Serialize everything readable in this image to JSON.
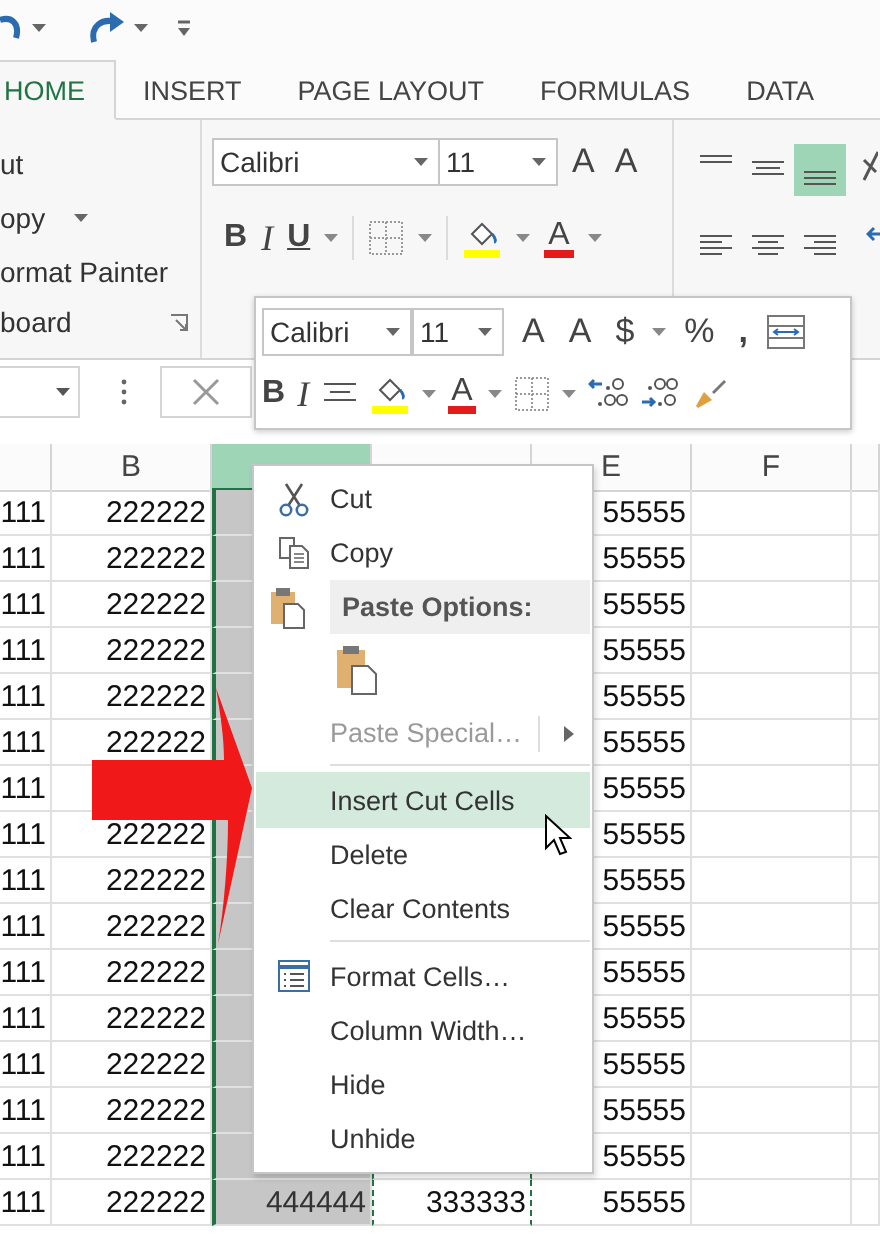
{
  "tabs": [
    {
      "label": "HOME",
      "selected": true
    },
    {
      "label": "INSERT",
      "selected": false
    },
    {
      "label": "PAGE LAYOUT",
      "selected": false
    },
    {
      "label": "FORMULAS",
      "selected": false
    },
    {
      "label": "DATA",
      "selected": false
    }
  ],
  "clipboard_group": {
    "cut": "ut",
    "copy": "opy",
    "format_painter": "ormat Painter",
    "label": "board"
  },
  "font_group": {
    "font": "Calibri",
    "size": "11",
    "grow": "A",
    "shrink": "A",
    "bold": "B",
    "italic": "I",
    "underline": "U",
    "font_color": "A"
  },
  "alignment_group": {
    "vertical": [
      {
        "selected": false
      },
      {
        "selected": false
      },
      {
        "selected": true
      }
    ],
    "horizontal": [
      {
        "selected": false
      },
      {
        "selected": false
      },
      {
        "selected": false
      }
    ]
  },
  "mini_toolbar": {
    "font": "Calibri",
    "size": "11",
    "grow": "A",
    "shrink": "A",
    "currency": "$",
    "percent": "%",
    "comma": ",",
    "bold": "B",
    "italic": "I",
    "font_color": "A"
  },
  "columns": [
    {
      "selected": false,
      "cut": false
    },
    {
      "label": "B",
      "selected": false,
      "cut": false
    },
    {
      "selected": true,
      "cut": false
    },
    {
      "selected": false,
      "cut": true
    },
    {
      "label": "E",
      "selected": false,
      "cut": false
    },
    {
      "label": "F",
      "selected": false,
      "cut": false
    },
    {
      "selected": false,
      "cut": false
    }
  ],
  "rows": [
    {
      "a": "111",
      "b": "222222",
      "e": "55555"
    },
    {
      "a": "111",
      "b": "222222",
      "e": "55555"
    },
    {
      "a": "111",
      "b": "222222",
      "e": "55555"
    },
    {
      "a": "111",
      "b": "222222",
      "e": "55555"
    },
    {
      "a": "111",
      "b": "222222",
      "e": "55555"
    },
    {
      "a": "111",
      "b": "222222",
      "e": "55555"
    },
    {
      "a": "111",
      "e": "55555"
    },
    {
      "a": "111",
      "b": "222222",
      "e": "55555"
    },
    {
      "a": "111",
      "b": "222222",
      "e": "55555"
    },
    {
      "a": "111",
      "b": "222222",
      "e": "55555"
    },
    {
      "a": "111",
      "b": "222222",
      "e": "55555"
    },
    {
      "a": "111",
      "b": "222222",
      "e": "55555"
    },
    {
      "a": "111",
      "b": "222222",
      "e": "55555"
    },
    {
      "a": "111",
      "b": "222222",
      "e": "55555"
    },
    {
      "a": "111",
      "b": "222222",
      "e": "55555"
    },
    {
      "a": "111",
      "b": "222222",
      "c": "444444",
      "d": "333333",
      "e": "55555"
    }
  ],
  "context_menu": {
    "items": [
      {
        "kind": "command",
        "label": "Cut",
        "selected": false,
        "disabled": false,
        "submenu": false,
        "divider_above": false
      },
      {
        "kind": "command",
        "label": "Copy",
        "selected": false,
        "disabled": false,
        "submenu": false,
        "divider_above": false
      },
      {
        "kind": "header",
        "label": "Paste Options:"
      },
      {
        "kind": "paste_options"
      },
      {
        "kind": "command",
        "label": "Paste Special…",
        "selected": false,
        "disabled": true,
        "submenu": true,
        "divider_above": false
      },
      {
        "kind": "command",
        "label": "Insert Cut Cells",
        "selected": true,
        "disabled": false,
        "submenu": false,
        "divider_above": true
      },
      {
        "kind": "command",
        "label": "Delete",
        "selected": false,
        "disabled": false,
        "submenu": false,
        "divider_above": false
      },
      {
        "kind": "command",
        "label": "Clear Contents",
        "selected": false,
        "disabled": false,
        "submenu": false,
        "divider_above": false
      },
      {
        "kind": "command",
        "label": "Format Cells…",
        "selected": false,
        "disabled": false,
        "submenu": false,
        "divider_above": true
      },
      {
        "kind": "command",
        "label": "Column Width…",
        "selected": false,
        "disabled": false,
        "submenu": false,
        "divider_above": false
      },
      {
        "kind": "command",
        "label": "Hide",
        "selected": false,
        "disabled": false,
        "submenu": false,
        "divider_above": false
      },
      {
        "kind": "command",
        "label": "Unhide",
        "selected": false,
        "disabled": false,
        "submenu": false,
        "divider_above": false
      }
    ]
  }
}
